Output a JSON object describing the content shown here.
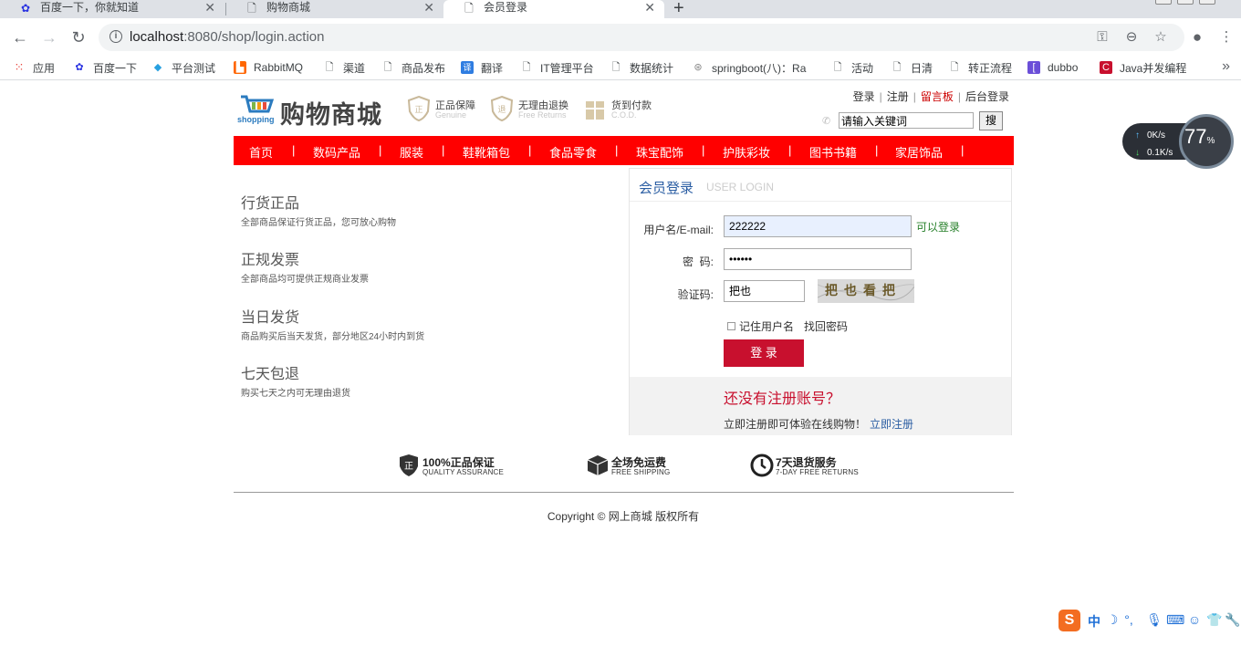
{
  "browser": {
    "tabs": [
      {
        "title": "百度一下，你就知道",
        "icon": "baidu-paw-icon"
      },
      {
        "title": "购物商城",
        "icon": "page-icon"
      },
      {
        "title": "会员登录",
        "icon": "page-icon",
        "active": true
      }
    ],
    "url": {
      "host": "localhost",
      "rest": ":8080/shop/login.action"
    },
    "bookmarks": [
      {
        "label": "应用",
        "icon": "apps-grid-icon"
      },
      {
        "label": "百度一下",
        "icon": "baidu-paw-icon"
      },
      {
        "label": "平台测试",
        "icon": "diamond-icon"
      },
      {
        "label": "RabbitMQ",
        "icon": "rabbitmq-icon"
      },
      {
        "label": "渠道",
        "icon": "page-icon"
      },
      {
        "label": "商品发布",
        "icon": "page-icon"
      },
      {
        "label": "翻译",
        "icon": "translate-icon"
      },
      {
        "label": "IT管理平台",
        "icon": "page-icon"
      },
      {
        "label": "数据统计",
        "icon": "page-icon"
      },
      {
        "label": "springboot(八)：Ra",
        "icon": "blog-icon"
      },
      {
        "label": "活动",
        "icon": "page-icon"
      },
      {
        "label": "日清",
        "icon": "page-icon"
      },
      {
        "label": "转正流程",
        "icon": "page-icon"
      },
      {
        "label": "dubbo",
        "icon": "dubbo-icon"
      },
      {
        "label": "Java并发编程",
        "icon": "csdn-icon"
      }
    ]
  },
  "site": {
    "logo_text": "购物商城",
    "logo_sub": "shopping",
    "guarantees": [
      {
        "title": "正品保障",
        "sub": "Genuine"
      },
      {
        "title": "无理由退换",
        "sub": "Free Returns"
      },
      {
        "title": "货到付款",
        "sub": "C.O.D."
      }
    ],
    "top_links": {
      "login": "登录",
      "register": "注册",
      "message": "留言板",
      "admin": "后台登录"
    },
    "search": {
      "value": "请输入关键词",
      "button": "搜"
    },
    "menu": [
      "首页",
      "数码产品",
      "服装",
      "鞋靴箱包",
      "食品零食",
      "珠宝配饰",
      "护肤彩妆",
      "图书书籍",
      "家居饰品"
    ],
    "features": [
      {
        "title": "行货正品",
        "desc": "全部商品保证行货正品，您可放心购物"
      },
      {
        "title": "正规发票",
        "desc": "全部商品均可提供正规商业发票"
      },
      {
        "title": "当日发货",
        "desc": "商品购买后当天发货，部分地区24小时内到货"
      },
      {
        "title": "七天包退",
        "desc": "购买七天之内可无理由退货"
      }
    ],
    "login": {
      "title_cn": "会员登录",
      "title_en": "USER LOGIN",
      "username_label": "用户名/E-mail:",
      "username_value": "222222",
      "username_ok": "可以登录",
      "password_label": "密  码:",
      "password_value": "••••••",
      "captcha_label": "验证码:",
      "captcha_value": "把也",
      "captcha_text": "把也看把",
      "remember_label": "记住用户名",
      "forgot_label": "找回密码",
      "submit": "登 录",
      "register_question": "还没有注册账号？",
      "register_tip": "立即注册即可体验在线购物！",
      "register_link": "立即注册"
    },
    "services": [
      {
        "title": "100%正品保证",
        "sub": "QUALITY ASSURANCE",
        "icon": "shield-icon"
      },
      {
        "title": "全场免运费",
        "sub": "FREE SHIPPING",
        "icon": "box-icon"
      },
      {
        "title": "7天退货服务",
        "sub": "7-DAY FREE RETURNS",
        "icon": "clock-icon"
      }
    ],
    "copyright": "Copyright © 网上商城 版权所有"
  },
  "overlay": {
    "speed_up": "0K/s",
    "speed_down": "0.1K/s",
    "percent": "77",
    "percent_unit": "%",
    "ime": {
      "lang": "中"
    }
  },
  "colors": {
    "menu_red": "#ff0000",
    "button_red": "#c8102e",
    "link_blue": "#2b5ea3",
    "ok_green": "#27802a"
  }
}
